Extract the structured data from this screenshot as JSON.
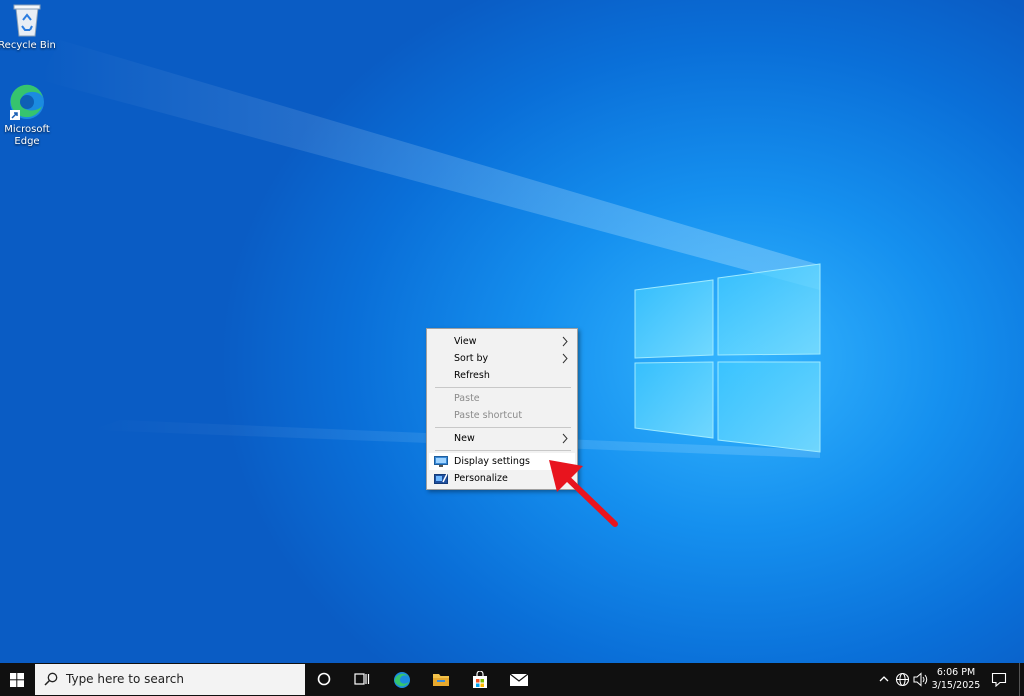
{
  "desktop": {
    "icons": [
      {
        "label": "Recycle Bin",
        "icon": "recycle-bin-icon"
      },
      {
        "label": "Microsoft Edge",
        "icon": "edge-icon"
      }
    ],
    "accent_color": "#0a6fd8"
  },
  "context_menu": {
    "items": [
      {
        "label": "View",
        "submenu": true,
        "enabled": true
      },
      {
        "label": "Sort by",
        "submenu": true,
        "enabled": true
      },
      {
        "label": "Refresh",
        "submenu": false,
        "enabled": true
      },
      {
        "label": "Paste",
        "submenu": false,
        "enabled": false
      },
      {
        "label": "Paste shortcut",
        "submenu": false,
        "enabled": false
      },
      {
        "label": "New",
        "submenu": true,
        "enabled": true
      },
      {
        "label": "Display settings",
        "submenu": false,
        "enabled": true,
        "highlighted": true,
        "icon": "display-icon"
      },
      {
        "label": "Personalize",
        "submenu": false,
        "enabled": true,
        "icon": "personalize-icon"
      }
    ]
  },
  "annotation": {
    "arrow_color": "#e8141e"
  },
  "taskbar": {
    "search_placeholder": "Type here to search",
    "pinned": [
      "cortana-icon",
      "task-view-icon",
      "edge-icon",
      "file-explorer-icon",
      "store-icon",
      "mail-icon"
    ],
    "tray_icons": [
      "chevron-up-icon",
      "network-icon",
      "volume-icon"
    ],
    "time": "6:06 PM",
    "date": "3/15/2025"
  }
}
